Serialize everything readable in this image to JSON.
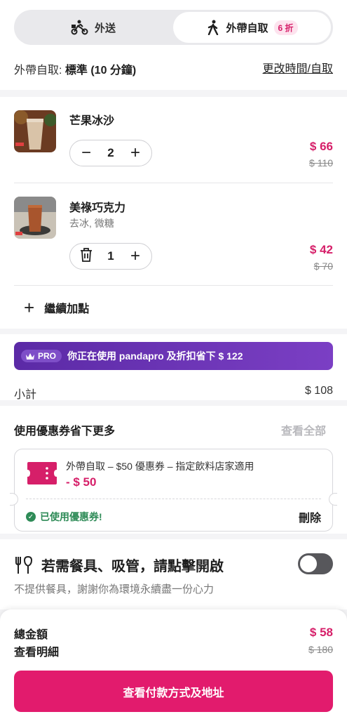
{
  "mode_toggle": {
    "delivery_label": "外送",
    "pickup_label": "外帶自取",
    "pickup_badge": "6 折",
    "selected": "pickup"
  },
  "pickup_info": {
    "prefix": "外帶自取: ",
    "value": "標準 (10 分鐘)",
    "change_link": "更改時間/自取"
  },
  "cart": {
    "items": [
      {
        "name": "芒果冰沙",
        "options": "",
        "quantity": "2",
        "price": "$ 66",
        "original_price": "$ 110",
        "left_control_icon": "minus-icon"
      },
      {
        "name": "美祿巧克力",
        "options": "去冰, 微糖",
        "quantity": "1",
        "price": "$ 42",
        "original_price": "$ 70",
        "left_control_icon": "trash-icon"
      }
    ],
    "add_more_label": "繼續加點"
  },
  "pro_banner": {
    "chip_label": "PRO",
    "text": "你正在使用 pandapro 及折扣省下 $ 122"
  },
  "subtotal": {
    "label": "小計",
    "value": "$ 108"
  },
  "voucher": {
    "section_title": "使用優惠券省下更多",
    "view_all": "查看全部",
    "description": "外帶自取 – $50 優惠券 – 指定飲料店家適用",
    "amount": "- $ 50",
    "applied_label": "已使用優惠券!",
    "delete_label": "刪除"
  },
  "cutlery": {
    "title": "若需餐具、吸管，請點擊開啟",
    "subtitle": "不提供餐具，謝謝你為環境永續盡一份心力",
    "enabled": false
  },
  "footer": {
    "total_label": "總金額",
    "detail_label": "查看明細",
    "total_price": "$ 58",
    "original_total": "$ 180",
    "cta_label": "查看付款方式及地址"
  },
  "colors": {
    "brand_pink": "#d61f69",
    "cta_pink": "#e21b6d",
    "pro_purple": "#5b2aa6",
    "success_green": "#2e8b57"
  }
}
